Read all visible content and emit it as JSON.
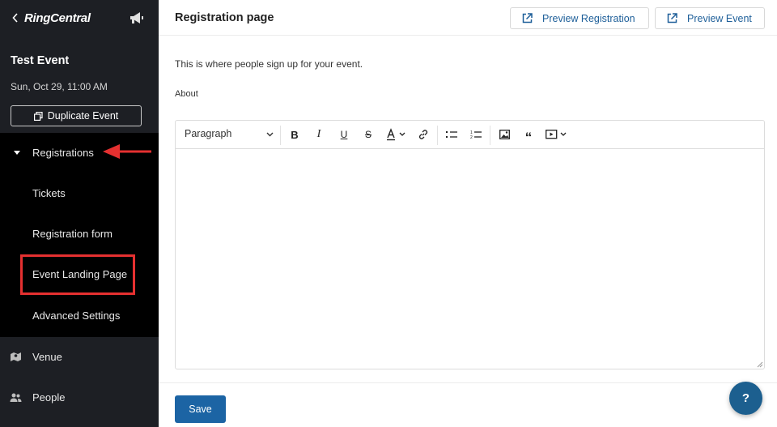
{
  "sidebar": {
    "brand": "RingCentral",
    "event_title": "Test Event",
    "event_date": "Sun, Oct 29, 11:00 AM",
    "duplicate_label": "Duplicate Event",
    "registrations_label": "Registrations",
    "sub_items": [
      {
        "label": "Tickets"
      },
      {
        "label": "Registration form"
      },
      {
        "label": "Event Landing Page"
      },
      {
        "label": "Advanced Settings"
      }
    ],
    "bottom_items": [
      {
        "label": "Venue",
        "icon": "venue-icon"
      },
      {
        "label": "People",
        "icon": "people-icon"
      }
    ]
  },
  "header": {
    "title": "Registration page",
    "preview_registration": "Preview Registration",
    "preview_event": "Preview Event"
  },
  "content": {
    "description": "This is where people sign up for your event.",
    "about_label": "About",
    "editor": {
      "block_format": "Paragraph",
      "tools": [
        "bold-icon",
        "italic-icon",
        "underline-icon",
        "strikethrough-icon",
        "text-color-icon",
        "link-icon",
        "bulleted-list-icon",
        "numbered-list-icon",
        "image-icon",
        "quote-icon",
        "media-embed-icon"
      ]
    }
  },
  "footer": {
    "save_label": "Save"
  },
  "help_label": "?",
  "colors": {
    "sidebar_bg": "#1d1f24",
    "subnav_bg": "#000000",
    "accent": "#1c64a4",
    "highlight": "#e53030"
  }
}
